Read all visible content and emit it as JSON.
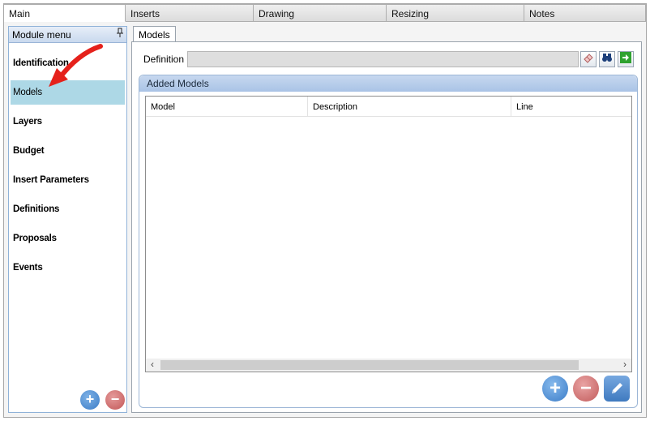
{
  "tabs": [
    "Main",
    "Inserts",
    "Drawing",
    "Resizing",
    "Notes"
  ],
  "module_menu": {
    "title": "Module menu",
    "items": [
      "Identification",
      "Models",
      "Layers",
      "Budget",
      "Insert Parameters",
      "Definitions",
      "Proposals",
      "Events"
    ],
    "selected": "Models"
  },
  "content": {
    "tab_label": "Models",
    "definition_label": "Definition",
    "definition_value": "",
    "group_title": "Added Models",
    "columns": [
      "Model",
      "Description",
      "Line"
    ],
    "rows": []
  },
  "icons": {
    "pin": "pin-icon",
    "eraser": "eraser-icon",
    "binoculars": "binoculars-icon",
    "go": "green-arrow-icon",
    "add": "plus-icon",
    "remove": "minus-icon",
    "edit": "pencil-icon",
    "annotation": "red-arrow-icon"
  },
  "colors": {
    "selected_item": "#add8e6",
    "header_blue": "#c9d9ee",
    "add_blue": "#3c7dc8",
    "remove_red": "#c25c5c",
    "annotation_red": "#e5211b"
  }
}
